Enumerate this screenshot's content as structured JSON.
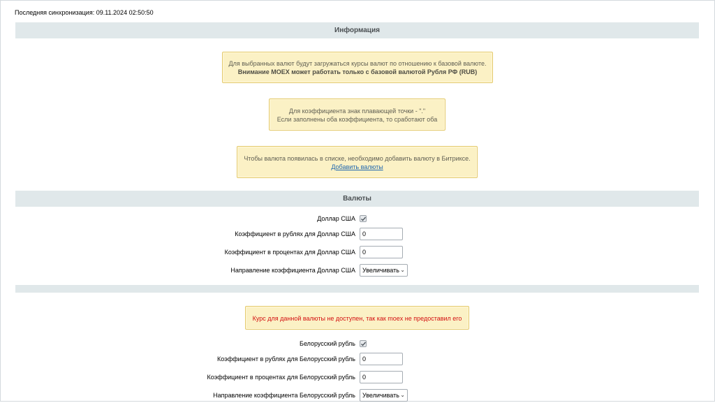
{
  "sync": {
    "text": "Последняя синхронизация: 09.11.2024 02:50:50"
  },
  "info_section": {
    "title": "Информация"
  },
  "notes": {
    "base_currency": {
      "line1": "Для выбранных валют будут загружаться курсы валют по отношению к базовой валюте.",
      "line2": "Внимание MOEX может работать только с базовой валютой Рубля РФ (RUB)"
    },
    "coefficient": {
      "line1": "Для коэффициента знак плавающей точки - \".\"",
      "line2": "Если заполнены оба коэффициента, то сработают оба"
    },
    "add_currency": {
      "line1": "Чтобы валюта появилась в списке, необходимо добавить валюту в Битриксе.",
      "link": "Добавить валюты"
    },
    "unavailable": {
      "text": "Курс для данной валюты не доступен, так как moex не предоставил его"
    }
  },
  "currencies_section": {
    "title": "Валюты"
  },
  "currencies": [
    {
      "name_label": "Доллар США",
      "checked": true,
      "rub_label": "Коэффициент в рублях для Доллар США",
      "rub_value": "0",
      "pct_label": "Коэффициент в процентах для Доллар США",
      "pct_value": "0",
      "dir_label": "Направление коэффициента Доллар США",
      "dir_value": "Увеличивать"
    },
    {
      "name_label": "Белорусский рубль",
      "checked": true,
      "rub_label": "Коэффициент в рублях для Белорусский рубль",
      "rub_value": "0",
      "pct_label": "Коэффициент в процентах для Белорусский рубль",
      "pct_value": "0",
      "dir_label": "Направление коэффициента Белорусский рубль",
      "dir_value": "Увеличивать"
    }
  ],
  "icons": {
    "checkbox": "checkmark-icon",
    "dropdown": "chevron-down-icon"
  },
  "colors": {
    "section_bg": "#e0e8ea",
    "note_bg": "#fbf1c5",
    "note_border": "#e3c96b",
    "error_text": "#d31010",
    "link": "#2067b0"
  }
}
